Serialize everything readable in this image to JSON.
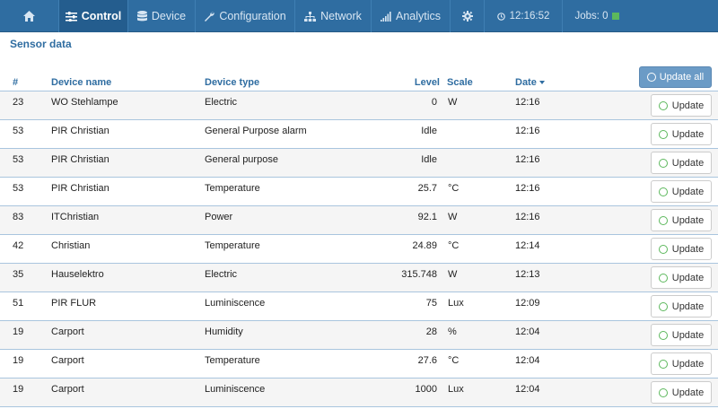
{
  "nav": {
    "home_icon": "home-icon",
    "items": [
      {
        "label": "Control",
        "icon": "sliders-icon",
        "active": true
      },
      {
        "label": "Device",
        "icon": "database-icon"
      },
      {
        "label": "Configuration",
        "icon": "wrench-icon"
      },
      {
        "label": "Network",
        "icon": "sitemap-icon"
      },
      {
        "label": "Analytics",
        "icon": "signal-bars-icon"
      }
    ],
    "settings_icon": "gear-icon",
    "clock": "12:16:52",
    "jobs_label": "Jobs: 0",
    "jobs_status_color": "#5cb85c"
  },
  "page": {
    "title": "Sensor data"
  },
  "table": {
    "headers": {
      "num": "#",
      "name": "Device name",
      "type": "Device type",
      "level": "Level",
      "scale": "Scale",
      "date": "Date"
    },
    "update_all_label": "Update all",
    "update_label": "Update",
    "rows": [
      {
        "num": "23",
        "name": "WO Stehlampe",
        "type": "Electric",
        "level": "0",
        "scale": "W",
        "date": "12:16"
      },
      {
        "num": "53",
        "name": "PIR Christian",
        "type": "General Purpose alarm",
        "level": "Idle",
        "scale": "",
        "date": "12:16"
      },
      {
        "num": "53",
        "name": "PIR Christian",
        "type": "General purpose",
        "level": "Idle",
        "scale": "",
        "date": "12:16"
      },
      {
        "num": "53",
        "name": "PIR Christian",
        "type": "Temperature",
        "level": "25.7",
        "scale": "°C",
        "date": "12:16"
      },
      {
        "num": "83",
        "name": "ITChristian",
        "type": "Power",
        "level": "92.1",
        "scale": "W",
        "date": "12:16"
      },
      {
        "num": "42",
        "name": "Christian",
        "type": "Temperature",
        "level": "24.89",
        "scale": "°C",
        "date": "12:14"
      },
      {
        "num": "35",
        "name": "Hauselektro",
        "type": "Electric",
        "level": "315.748",
        "scale": "W",
        "date": "12:13"
      },
      {
        "num": "51",
        "name": "PIR FLUR",
        "type": "Luminiscence",
        "level": "75",
        "scale": "Lux",
        "date": "12:09"
      },
      {
        "num": "19",
        "name": "Carport",
        "type": "Humidity",
        "level": "28",
        "scale": "%",
        "date": "12:04"
      },
      {
        "num": "19",
        "name": "Carport",
        "type": "Temperature",
        "level": "27.6",
        "scale": "°C",
        "date": "12:04"
      },
      {
        "num": "19",
        "name": "Carport",
        "type": "Luminiscence",
        "level": "1000",
        "scale": "Lux",
        "date": "12:04"
      }
    ]
  },
  "colors": {
    "nav_bg": "#2f6da1",
    "accent": "#2f6da1",
    "status_green": "#5cb85c"
  }
}
